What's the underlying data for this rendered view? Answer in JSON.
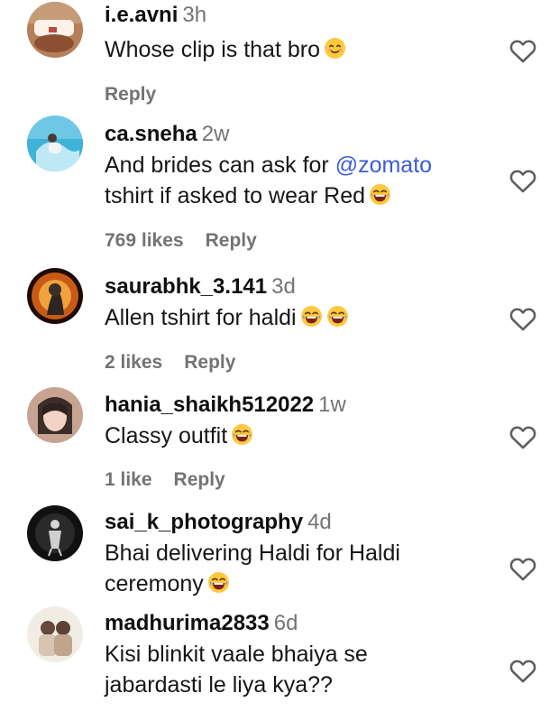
{
  "comments": [
    {
      "username": "i.e.avni",
      "time": "3h",
      "text": "Whose clip is that bro",
      "emoji": "smiling-face-emoji",
      "likes": "",
      "reply": "Reply"
    },
    {
      "username": "ca.sneha",
      "time": "2w",
      "text_before": "And brides can ask for",
      "mention": "@zomato",
      "text_after": "tshirt if asked to wear Red",
      "emoji": "laughing-emoji",
      "likes": "769 likes",
      "reply": "Reply"
    },
    {
      "username": "saurabhk_3.141",
      "time": "3d",
      "text": "Allen tshirt for haldi",
      "emoji": "laughing-emoji",
      "likes": "2 likes",
      "reply": "Reply"
    },
    {
      "username": "hania_shaikh512022",
      "time": "1w",
      "text": "Classy outfit",
      "emoji": "laughing-emoji",
      "likes": "1 like",
      "reply": "Reply"
    },
    {
      "username": "sai_k_photography",
      "time": "4d",
      "text_line1": "Bhai delivering Haldi for Haldi",
      "text_line2": "ceremony",
      "emoji": "laughing-emoji"
    },
    {
      "username": "madhurima2833",
      "time": "6d",
      "text_line1": "Kisi blinkit vaale bhaiya se",
      "text_line2": "jabardasti le liya kya??"
    }
  ],
  "colors": {
    "username": "#0f0f0f",
    "meta": "#737373",
    "mention": "#3b5bd6"
  }
}
